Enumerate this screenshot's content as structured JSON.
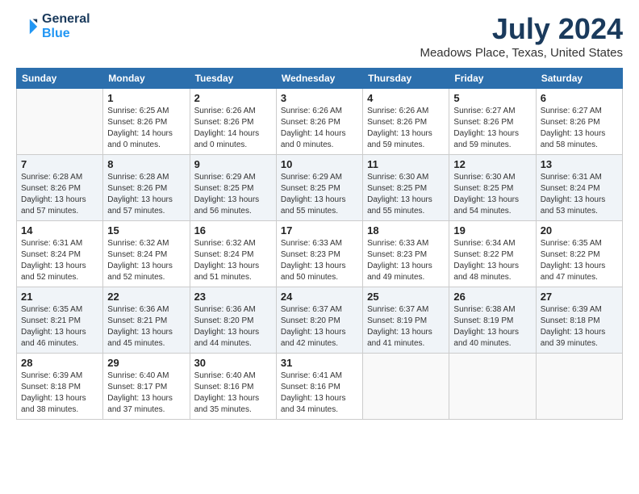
{
  "logo": {
    "line1": "General",
    "line2": "Blue"
  },
  "title": "July 2024",
  "location": "Meadows Place, Texas, United States",
  "days_header": [
    "Sunday",
    "Monday",
    "Tuesday",
    "Wednesday",
    "Thursday",
    "Friday",
    "Saturday"
  ],
  "weeks": [
    [
      {
        "day": "",
        "info": ""
      },
      {
        "day": "1",
        "info": "Sunrise: 6:25 AM\nSunset: 8:26 PM\nDaylight: 14 hours\nand 0 minutes."
      },
      {
        "day": "2",
        "info": "Sunrise: 6:26 AM\nSunset: 8:26 PM\nDaylight: 14 hours\nand 0 minutes."
      },
      {
        "day": "3",
        "info": "Sunrise: 6:26 AM\nSunset: 8:26 PM\nDaylight: 14 hours\nand 0 minutes."
      },
      {
        "day": "4",
        "info": "Sunrise: 6:26 AM\nSunset: 8:26 PM\nDaylight: 13 hours\nand 59 minutes."
      },
      {
        "day": "5",
        "info": "Sunrise: 6:27 AM\nSunset: 8:26 PM\nDaylight: 13 hours\nand 59 minutes."
      },
      {
        "day": "6",
        "info": "Sunrise: 6:27 AM\nSunset: 8:26 PM\nDaylight: 13 hours\nand 58 minutes."
      }
    ],
    [
      {
        "day": "7",
        "info": "Sunrise: 6:28 AM\nSunset: 8:26 PM\nDaylight: 13 hours\nand 57 minutes."
      },
      {
        "day": "8",
        "info": "Sunrise: 6:28 AM\nSunset: 8:26 PM\nDaylight: 13 hours\nand 57 minutes."
      },
      {
        "day": "9",
        "info": "Sunrise: 6:29 AM\nSunset: 8:25 PM\nDaylight: 13 hours\nand 56 minutes."
      },
      {
        "day": "10",
        "info": "Sunrise: 6:29 AM\nSunset: 8:25 PM\nDaylight: 13 hours\nand 55 minutes."
      },
      {
        "day": "11",
        "info": "Sunrise: 6:30 AM\nSunset: 8:25 PM\nDaylight: 13 hours\nand 55 minutes."
      },
      {
        "day": "12",
        "info": "Sunrise: 6:30 AM\nSunset: 8:25 PM\nDaylight: 13 hours\nand 54 minutes."
      },
      {
        "day": "13",
        "info": "Sunrise: 6:31 AM\nSunset: 8:24 PM\nDaylight: 13 hours\nand 53 minutes."
      }
    ],
    [
      {
        "day": "14",
        "info": "Sunrise: 6:31 AM\nSunset: 8:24 PM\nDaylight: 13 hours\nand 52 minutes."
      },
      {
        "day": "15",
        "info": "Sunrise: 6:32 AM\nSunset: 8:24 PM\nDaylight: 13 hours\nand 52 minutes."
      },
      {
        "day": "16",
        "info": "Sunrise: 6:32 AM\nSunset: 8:24 PM\nDaylight: 13 hours\nand 51 minutes."
      },
      {
        "day": "17",
        "info": "Sunrise: 6:33 AM\nSunset: 8:23 PM\nDaylight: 13 hours\nand 50 minutes."
      },
      {
        "day": "18",
        "info": "Sunrise: 6:33 AM\nSunset: 8:23 PM\nDaylight: 13 hours\nand 49 minutes."
      },
      {
        "day": "19",
        "info": "Sunrise: 6:34 AM\nSunset: 8:22 PM\nDaylight: 13 hours\nand 48 minutes."
      },
      {
        "day": "20",
        "info": "Sunrise: 6:35 AM\nSunset: 8:22 PM\nDaylight: 13 hours\nand 47 minutes."
      }
    ],
    [
      {
        "day": "21",
        "info": "Sunrise: 6:35 AM\nSunset: 8:21 PM\nDaylight: 13 hours\nand 46 minutes."
      },
      {
        "day": "22",
        "info": "Sunrise: 6:36 AM\nSunset: 8:21 PM\nDaylight: 13 hours\nand 45 minutes."
      },
      {
        "day": "23",
        "info": "Sunrise: 6:36 AM\nSunset: 8:20 PM\nDaylight: 13 hours\nand 44 minutes."
      },
      {
        "day": "24",
        "info": "Sunrise: 6:37 AM\nSunset: 8:20 PM\nDaylight: 13 hours\nand 42 minutes."
      },
      {
        "day": "25",
        "info": "Sunrise: 6:37 AM\nSunset: 8:19 PM\nDaylight: 13 hours\nand 41 minutes."
      },
      {
        "day": "26",
        "info": "Sunrise: 6:38 AM\nSunset: 8:19 PM\nDaylight: 13 hours\nand 40 minutes."
      },
      {
        "day": "27",
        "info": "Sunrise: 6:39 AM\nSunset: 8:18 PM\nDaylight: 13 hours\nand 39 minutes."
      }
    ],
    [
      {
        "day": "28",
        "info": "Sunrise: 6:39 AM\nSunset: 8:18 PM\nDaylight: 13 hours\nand 38 minutes."
      },
      {
        "day": "29",
        "info": "Sunrise: 6:40 AM\nSunset: 8:17 PM\nDaylight: 13 hours\nand 37 minutes."
      },
      {
        "day": "30",
        "info": "Sunrise: 6:40 AM\nSunset: 8:16 PM\nDaylight: 13 hours\nand 35 minutes."
      },
      {
        "day": "31",
        "info": "Sunrise: 6:41 AM\nSunset: 8:16 PM\nDaylight: 13 hours\nand 34 minutes."
      },
      {
        "day": "",
        "info": ""
      },
      {
        "day": "",
        "info": ""
      },
      {
        "day": "",
        "info": ""
      }
    ]
  ]
}
